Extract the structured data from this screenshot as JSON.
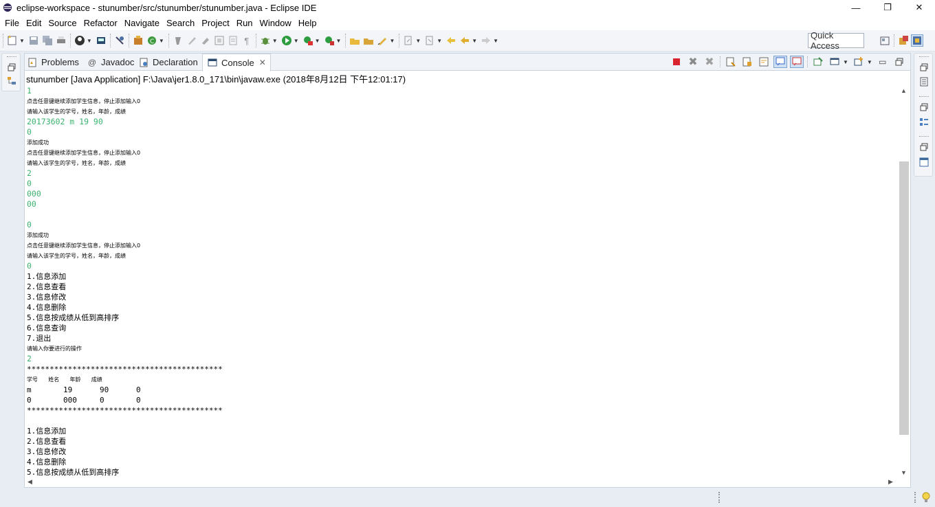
{
  "window": {
    "title": "eclipse-workspace - stunumber/src/stunumber/stunumber.java - Eclipse IDE",
    "minimize": "—",
    "maximize": "❐",
    "close": "✕"
  },
  "menu": [
    "File",
    "Edit",
    "Source",
    "Refactor",
    "Navigate",
    "Search",
    "Project",
    "Run",
    "Window",
    "Help"
  ],
  "toolbar": {
    "quick_access": "Quick Access"
  },
  "tabs": {
    "problems": "Problems",
    "javadoc": "Javadoc",
    "declaration": "Declaration",
    "console": "Console"
  },
  "console": {
    "process_title": "stunumber [Java Application] F:\\Java\\jer1.8.0_171\\bin\\javaw.exe (2018年8月12日 下午12:01:17)",
    "lines": [
      {
        "text": "1",
        "kind": "input"
      },
      {
        "text": "点击任意键继续添加学生信息，停止添加输入0",
        "kind": "cn"
      },
      {
        "text": "请输入该学生的学号，姓名，年龄，成绩",
        "kind": "cn"
      },
      {
        "text": "20173602 m 19 90",
        "kind": "input"
      },
      {
        "text": "0",
        "kind": "input"
      },
      {
        "text": "添加成功",
        "kind": "cn"
      },
      {
        "text": "点击任意键继续添加学生信息，停止添加输入0",
        "kind": "cn"
      },
      {
        "text": "请输入该学生的学号，姓名，年龄，成绩",
        "kind": "cn"
      },
      {
        "text": "2",
        "kind": "input"
      },
      {
        "text": "0",
        "kind": "input"
      },
      {
        "text": "000",
        "kind": "input"
      },
      {
        "text": "00",
        "kind": "input"
      },
      {
        "text": "",
        "kind": "input"
      },
      {
        "text": "0",
        "kind": "input"
      },
      {
        "text": "添加成功",
        "kind": "cn"
      },
      {
        "text": "点击任意键继续添加学生信息，停止添加输入0",
        "kind": "cn"
      },
      {
        "text": "请输入该学生的学号，姓名，年龄，成绩",
        "kind": "cn"
      },
      {
        "text": "0",
        "kind": "input"
      },
      {
        "text": "1.信息添加",
        "kind": "out"
      },
      {
        "text": "2.信息查看",
        "kind": "out"
      },
      {
        "text": "3.信息修改",
        "kind": "out"
      },
      {
        "text": "4.信息删除",
        "kind": "out"
      },
      {
        "text": "5.信息按成绩从低到高排序",
        "kind": "out"
      },
      {
        "text": "6.信息查询",
        "kind": "out"
      },
      {
        "text": "7.退出",
        "kind": "out"
      },
      {
        "text": "请输入你要进行的操作",
        "kind": "cn"
      },
      {
        "text": "2",
        "kind": "input"
      },
      {
        "text": "*******************************************",
        "kind": "out"
      },
      {
        "text": "学号      姓名      年龄      成绩",
        "kind": "cn"
      },
      {
        "text": "m       19      90      0",
        "kind": "out"
      },
      {
        "text": "0       000     0       0",
        "kind": "out"
      },
      {
        "text": "*******************************************",
        "kind": "out"
      },
      {
        "text": "",
        "kind": "out"
      },
      {
        "text": "1.信息添加",
        "kind": "out"
      },
      {
        "text": "2.信息查看",
        "kind": "out"
      },
      {
        "text": "3.信息修改",
        "kind": "out"
      },
      {
        "text": "4.信息删除",
        "kind": "out"
      },
      {
        "text": "5.信息按成绩从低到高排序",
        "kind": "out"
      }
    ]
  }
}
